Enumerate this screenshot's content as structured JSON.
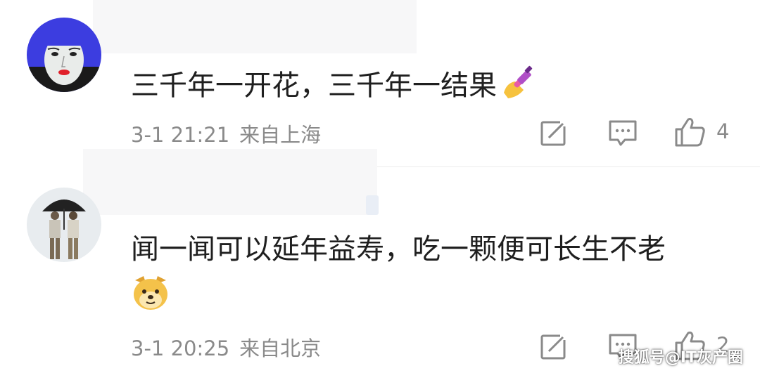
{
  "comments": [
    {
      "text": "三千年一开花，三千年一结果",
      "trailing_emoji": "nail-polish",
      "time": "3-1 21:21",
      "location": "来自上海",
      "likes": "4"
    },
    {
      "text": "闻一闻可以延年益寿，吃一颗便可长生不老",
      "trailing_emoji": "doge",
      "time": "3-1 20:25",
      "location": "来自北京",
      "likes": "2"
    }
  ],
  "icons": {
    "edit": "edit-icon",
    "reply": "comment-icon",
    "like": "thumbs-up-icon"
  },
  "colors": {
    "meta_text": "#8a8a8a",
    "icon_stroke": "#8a8a8a",
    "name_mask": "#f7f7f8"
  },
  "watermark": "搜狐号@IT灰产圈"
}
